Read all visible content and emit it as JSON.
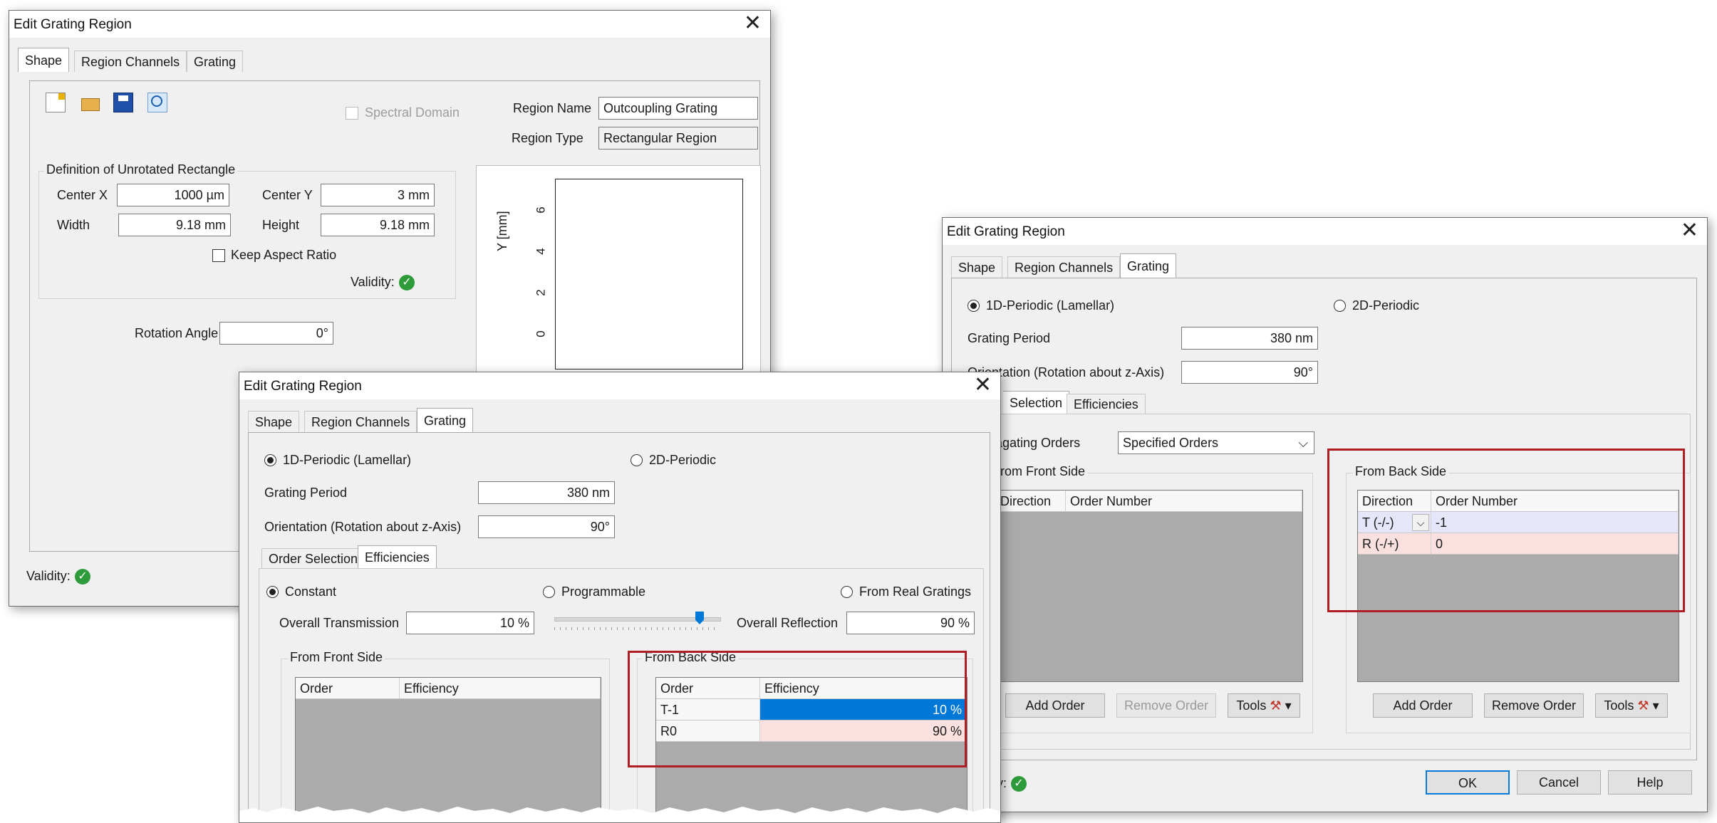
{
  "title": "Edit Grating Region",
  "tabs": [
    "Shape",
    "Region Channels",
    "Grating"
  ],
  "shape": {
    "spectral_domain": "Spectral Domain",
    "region_name_label": "Region Name",
    "region_name": "Outcoupling Grating",
    "region_type_label": "Region Type",
    "region_type": "Rectangular Region",
    "group_title": "Definition of Unrotated Rectangle",
    "center_x_label": "Center X",
    "center_x": "1000 µm",
    "center_y_label": "Center Y",
    "center_y": "3 mm",
    "width_label": "Width",
    "width": "9.18 mm",
    "height_label": "Height",
    "height": "9.18 mm",
    "keep_aspect": "Keep Aspect Ratio",
    "validity_label": "Validity:",
    "rotation_label": "Rotation Angle",
    "rotation": "0°",
    "plot_ylabel": "Y [mm]",
    "plot_yticks": [
      "6",
      "4",
      "2",
      "0"
    ]
  },
  "grating": {
    "periodic_1d": "1D-Periodic (Lamellar)",
    "periodic_2d": "2D-Periodic",
    "period_label": "Grating Period",
    "period": "380 nm",
    "orientation_label": "Orientation (Rotation about z-Axis)",
    "orientation": "90°",
    "subtabs": [
      "Order Selection",
      "Efficiencies"
    ],
    "subtab_partial": "Selection",
    "orientation_partial": "Orientation (Rotation about z-Axis)"
  },
  "efficiencies": {
    "constant": "Constant",
    "programmable": "Programmable",
    "from_real": "From Real Gratings",
    "overall_transmission_label": "Overall Transmission",
    "overall_transmission": "10 %",
    "overall_reflection_label": "Overall Reflection",
    "overall_reflection": "90 %",
    "front_title": "From Front Side",
    "back_title": "From Back Side",
    "columns": [
      "Order",
      "Efficiency"
    ],
    "back_rows": [
      {
        "order": "T-1",
        "efficiency": "10 %"
      },
      {
        "order": "R0",
        "efficiency": "90 %"
      }
    ],
    "slider_value": 0.9
  },
  "order_selection": {
    "propagating_label": "agating Orders",
    "propagating_value": "Specified Orders",
    "front_title": "rom Front Side",
    "back_title": "From Back Side",
    "front_columns": [
      "Direction",
      "Order Number"
    ],
    "back_columns": [
      "Direction",
      "Order Number"
    ],
    "back_rows": [
      {
        "direction": "T (-/-)",
        "order": "-1"
      },
      {
        "direction": "R (-/+)",
        "order": "0"
      }
    ],
    "add_order": "Add Order",
    "remove_order": "Remove Order",
    "tools": "Tools"
  },
  "footer": {
    "validity": "Validity:",
    "validity_partial": "y:",
    "ok": "OK",
    "cancel": "Cancel",
    "help": "Help"
  },
  "colors": {
    "highlight_blue": "#0078d7",
    "pink_row": "#fbe0e0",
    "lavender_row": "#e6e6fa",
    "red_frame": "#b01e23",
    "valid_green": "#2e9b3a"
  }
}
